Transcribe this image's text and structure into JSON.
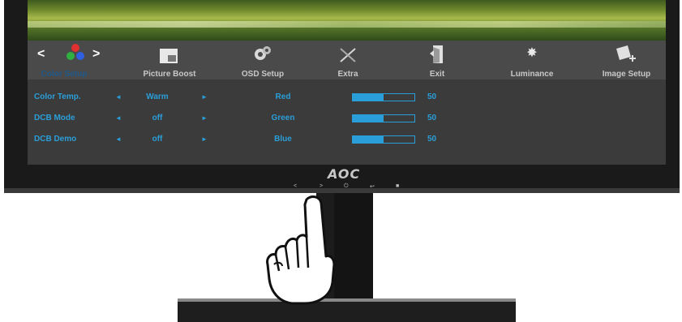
{
  "monitor": {
    "brand": "AOC",
    "bezel_buttons": [
      "<",
      ">",
      "⏻",
      "↩",
      "■"
    ]
  },
  "osd": {
    "tabs": [
      {
        "label": "Color Setup",
        "icon": "color-dots-icon",
        "active": true
      },
      {
        "label": "Picture Boost",
        "icon": "picture-boost-icon",
        "active": false
      },
      {
        "label": "OSD Setup",
        "icon": "osd-setup-icon",
        "active": false
      },
      {
        "label": "Extra",
        "icon": "extra-tools-icon",
        "active": false
      },
      {
        "label": "Exit",
        "icon": "exit-door-icon",
        "active": false
      },
      {
        "label": "Luminance",
        "icon": "luminance-sun-icon",
        "active": false
      },
      {
        "label": "Image Setup",
        "icon": "image-setup-icon",
        "active": false
      }
    ],
    "nav_left": "<",
    "nav_right": ">",
    "settings": [
      {
        "label": "Color Temp.",
        "value": "Warm"
      },
      {
        "label": "DCB Mode",
        "value": "off"
      },
      {
        "label": "DCB Demo",
        "value": "off"
      }
    ],
    "colors": [
      {
        "label": "Red",
        "value": "50",
        "level": 50
      },
      {
        "label": "Green",
        "value": "50",
        "level": 50
      },
      {
        "label": "Blue",
        "value": "50",
        "level": 50
      }
    ],
    "left_arrow_glyph": "◄",
    "right_arrow_glyph": "►",
    "accent_color": "#2a9ed8"
  }
}
